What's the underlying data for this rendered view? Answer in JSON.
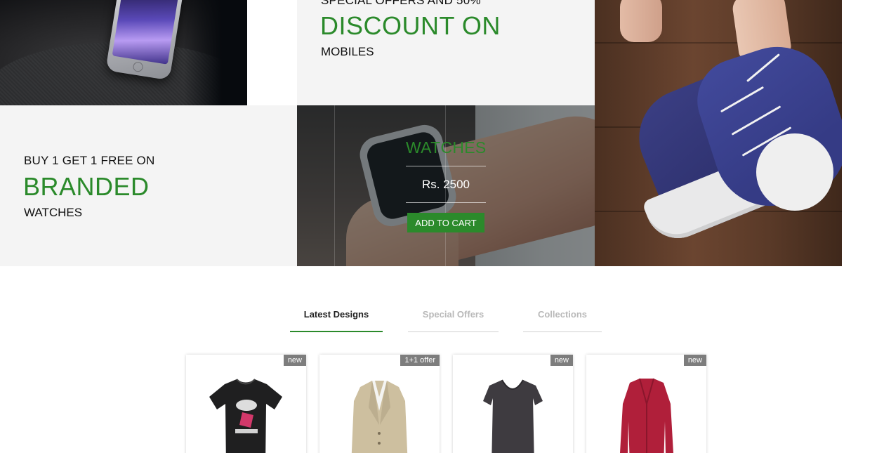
{
  "banners": {
    "top_offer": {
      "line1": "SPECIAL OFFERS AND 50%",
      "headline": "DISCOUNT ON",
      "line3": "MOBILES"
    },
    "left_offer": {
      "line1": "BUY 1 GET 1 FREE ON",
      "headline": "BRANDED",
      "line3": "WATCHES"
    },
    "watch_card": {
      "title": "WATCHES",
      "price": "Rs. 2500",
      "cart_label": "ADD TO CART"
    }
  },
  "tabs": [
    {
      "label": "Latest Designs",
      "active": true
    },
    {
      "label": "Special Offers",
      "active": false
    },
    {
      "label": "Collections",
      "active": false
    }
  ],
  "products": [
    {
      "badge": "new",
      "icon": "black-printed-tshirt-image"
    },
    {
      "badge": "1+1 offer",
      "icon": "beige-blazer-image"
    },
    {
      "badge": "new",
      "icon": "dark-grey-top-image"
    },
    {
      "badge": "new",
      "icon": "red-cardigan-image"
    }
  ],
  "colors": {
    "accent_green": "#2b8a2b",
    "panel_grey": "#f4f4f4",
    "badge_grey": "#7d7d7d"
  }
}
